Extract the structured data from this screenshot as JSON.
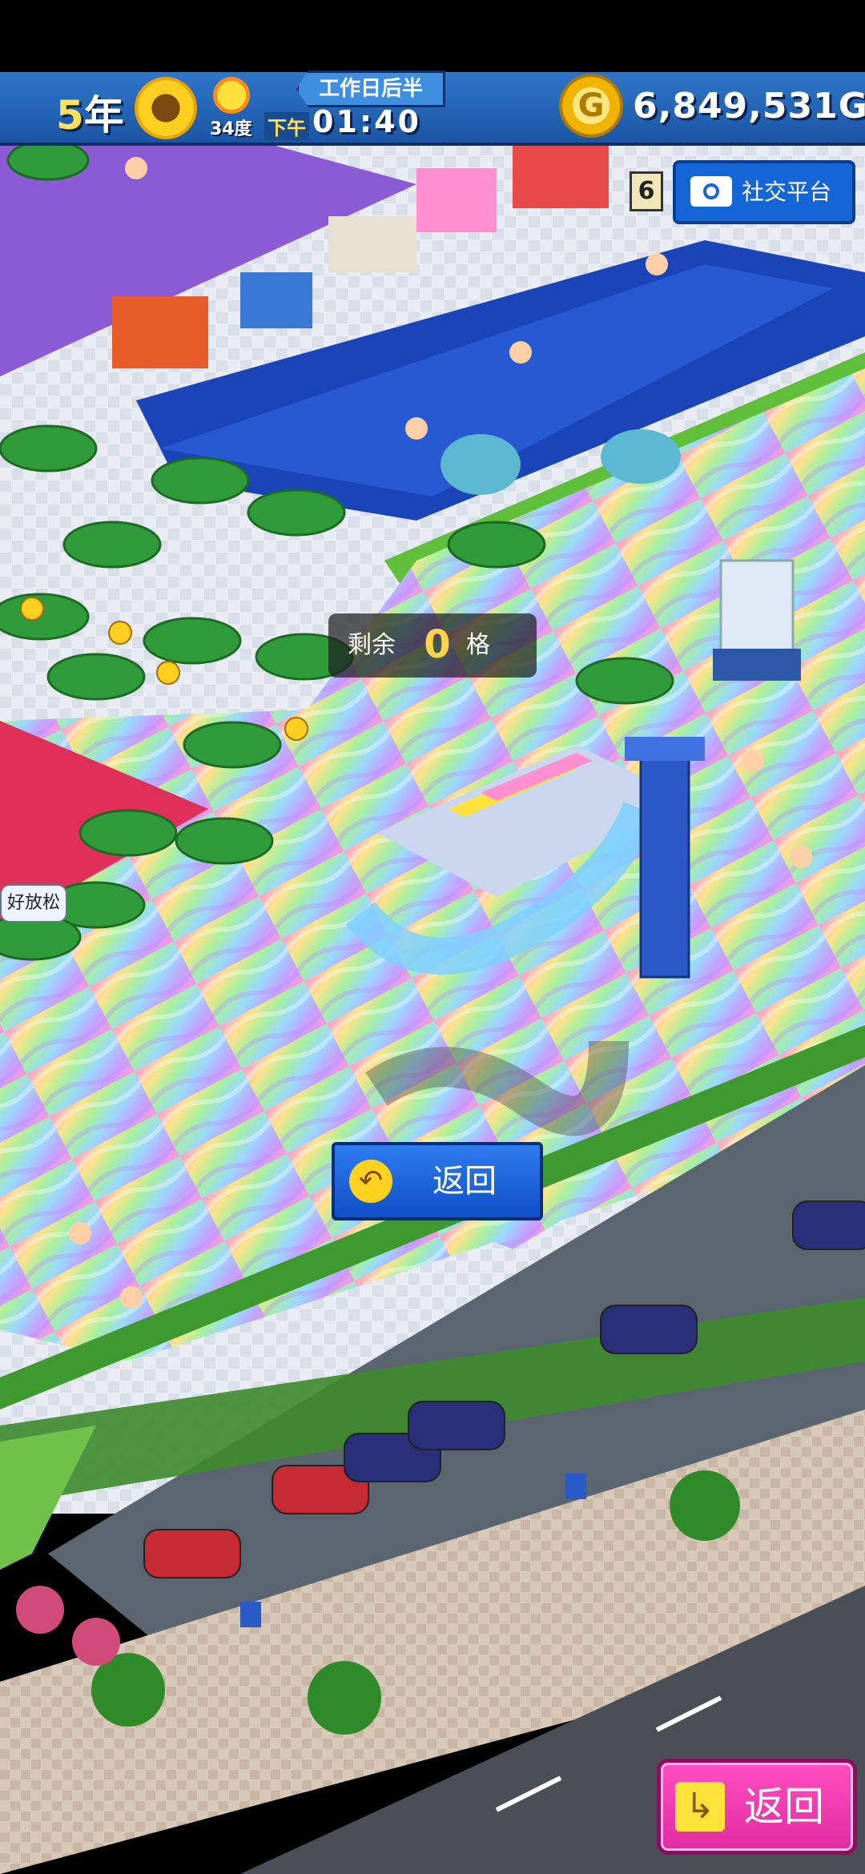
{
  "hud": {
    "year_num": "5",
    "year_unit": "年",
    "temperature": "34度",
    "ampm": "下午",
    "day_phase": "工作日后半",
    "clock": "01:40",
    "money": "6,849,531G",
    "coin_symbol": "G"
  },
  "social": {
    "badge": "6",
    "label": "社交平台"
  },
  "remaining": {
    "prefix": "剩余",
    "count": "0",
    "suffix": "格"
  },
  "back_center": {
    "label": "返回",
    "icon": "back-arrow-icon"
  },
  "back_corner": {
    "label": "返回",
    "icon": "back-arrow-icon"
  },
  "chat_bubble": "好放松",
  "colors": {
    "hud_blue": "#1c55a5",
    "button_blue": "#1466d6",
    "button_pink": "#e22aa1",
    "gold": "#f0b400"
  }
}
